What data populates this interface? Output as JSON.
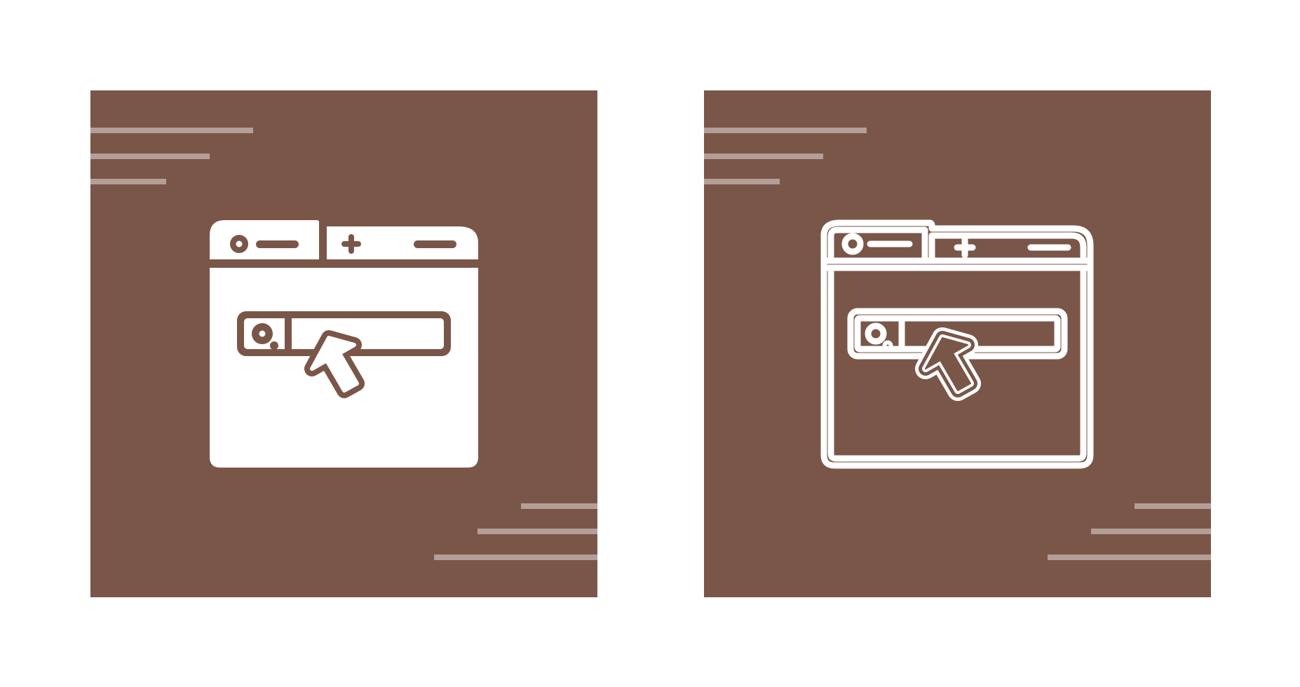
{
  "colors": {
    "background": "#ffffff",
    "tile": "#7a5649",
    "icon": "#ffffff",
    "stripe": "#b39f98"
  },
  "icons": [
    {
      "name": "browser-search-cursor-icon",
      "style": "glyph"
    },
    {
      "name": "browser-search-cursor-icon",
      "style": "line"
    }
  ]
}
